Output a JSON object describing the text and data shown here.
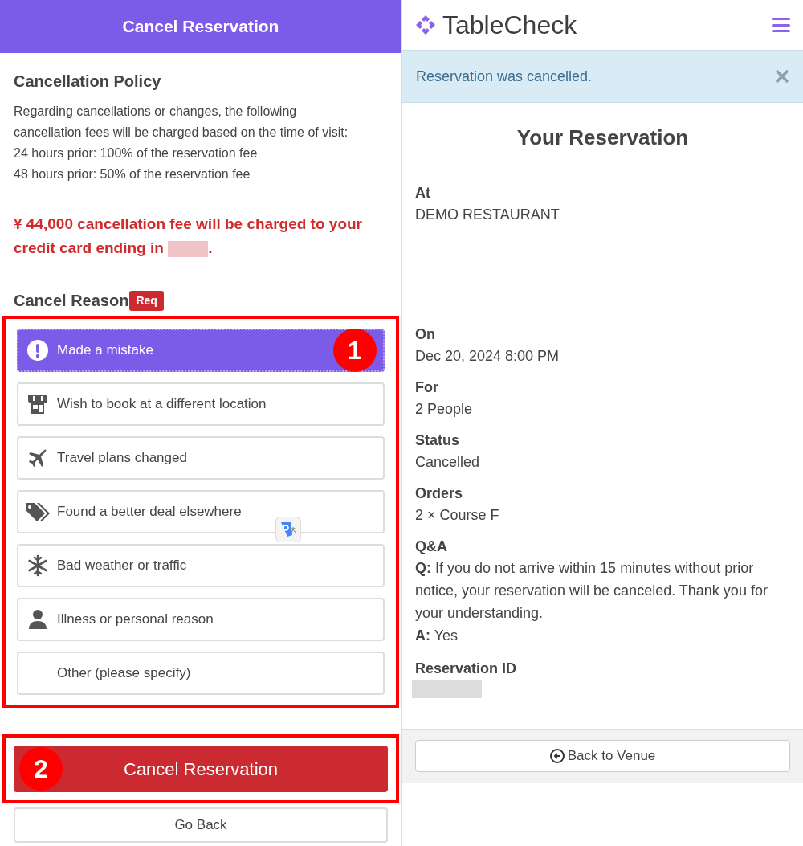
{
  "cancel_panel": {
    "title": "Cancel Reservation",
    "policy_heading": "Cancellation Policy",
    "policy_text": "Regarding cancellations or changes, the following cancellation fees will be charged based on the time of visit:",
    "policy_lines": [
      "24 hours prior: 100% of the reservation fee",
      "48 hours prior: 50% of the reservation fee"
    ],
    "fee_notice": "¥ 44,000 cancellation fee will be charged to your credit card ending in",
    "fee_notice_end": ".",
    "reason_label": "Cancel Reason",
    "required_badge": "Req",
    "reasons": [
      {
        "label": "Made a mistake",
        "kind": "exclamation",
        "selected": true
      },
      {
        "label": "Wish to book at a different location",
        "kind": "store",
        "selected": false
      },
      {
        "label": "Travel plans changed",
        "kind": "plane",
        "selected": false
      },
      {
        "label": "Found a better deal elsewhere",
        "kind": "tag",
        "selected": false
      },
      {
        "label": "Bad weather or traffic",
        "kind": "snowflake",
        "selected": false
      },
      {
        "label": "Illness or personal reason",
        "kind": "person",
        "selected": false
      },
      {
        "label": "Other (please specify)",
        "selected": false
      }
    ],
    "submit": "Cancel Reservation",
    "back": "Go Back"
  },
  "annotations": [
    {
      "number": "1"
    },
    {
      "number": "2"
    }
  ],
  "reservation_panel": {
    "brand": "TableCheck",
    "alert": "Reservation was cancelled.",
    "heading": "Your Reservation",
    "venue": {
      "label": "At",
      "value": "DEMO RESTAURANT"
    },
    "fields": [
      {
        "label": "On",
        "value": "Dec 20, 2024 8:00 PM"
      },
      {
        "label": "For",
        "value": "2 People"
      },
      {
        "label": "Status",
        "value": "Cancelled"
      },
      {
        "label": "Orders",
        "value": "2 × Course F"
      }
    ],
    "qa": {
      "label": "Q&A",
      "question": "**Q:** If you do not arrive within 15 minutes without prior notice, your reservation will be canceled. Thank you for your understanding.",
      "answer": "**A:** Yes"
    },
    "id_label": "Reservation ID",
    "back_button": "Back to Venue"
  }
}
